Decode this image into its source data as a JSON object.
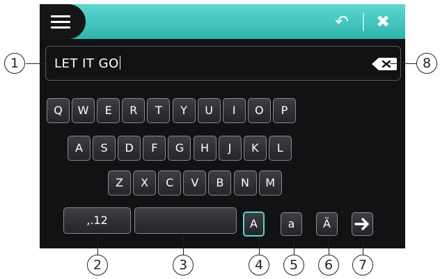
{
  "input": {
    "value": "LET IT GO"
  },
  "keyboard": {
    "row1": [
      "Q",
      "W",
      "E",
      "R",
      "T",
      "Y",
      "U",
      "I",
      "O",
      "P"
    ],
    "row2": [
      "A",
      "S",
      "D",
      "F",
      "G",
      "H",
      "J",
      "K",
      "L"
    ],
    "row3": [
      "Z",
      "X",
      "C",
      "V",
      "B",
      "N",
      "M"
    ],
    "bottom": {
      "symbols_label": ",.12",
      "space_label": "",
      "upper_label": "A",
      "lower_label": "a",
      "umlaut_label": "Ä"
    }
  },
  "icons": {
    "menu": "menu-icon",
    "back": "undo-icon",
    "close": "close-icon",
    "backspace": "backspace-icon",
    "next": "arrow-right-icon"
  },
  "callouts": [
    "1",
    "2",
    "3",
    "4",
    "5",
    "6",
    "7",
    "8"
  ],
  "colors": {
    "accent": "#3cc3bd",
    "background": "#111214",
    "key_border": "#8a8a8c"
  }
}
